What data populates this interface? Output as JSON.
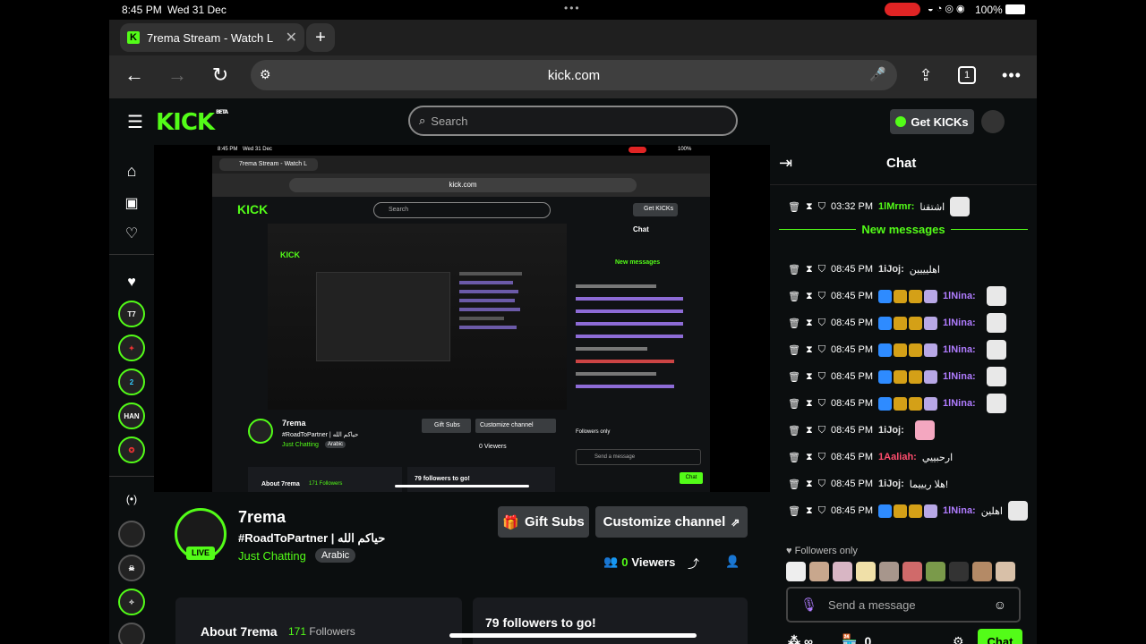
{
  "status_bar": {
    "time": "8:45 PM",
    "date": "Wed 31 Dec",
    "battery": "100%"
  },
  "browser": {
    "tab_title": "7rema Stream - Watch L",
    "url": "kick.com",
    "tab_count": "1"
  },
  "header": {
    "logo": "KICK",
    "logo_badge": "BETA",
    "search_placeholder": "Search",
    "get_kicks": "Get KICKs"
  },
  "nested_screen": {
    "time": "8:45 PM",
    "date": "Wed 31 Dec",
    "battery": "100%",
    "tab_title": "7rema Stream - Watch L",
    "url": "kick.com",
    "search_placeholder": "Search",
    "get_kicks": "Get KICKs",
    "chat_title": "Chat",
    "new_messages": "New messages",
    "channel_name": "7rema",
    "channel_title": "#RoadToPartner | حياكم الله",
    "category": "Just Chatting",
    "language": "Arabic",
    "viewers": "0 Viewers",
    "gift_subs": "Gift Subs",
    "customize": "Customize channel",
    "about": "About 7rema",
    "followers": "171 Followers",
    "followers_to_go": "79 followers to go!",
    "followers_only": "Followers only",
    "send_message": "Send a message",
    "chat_button": "Chat"
  },
  "channel": {
    "name": "7rema",
    "title": "#RoadToPartner | حياكم الله",
    "category": "Just Chatting",
    "language": "Arabic",
    "live_label": "LIVE",
    "viewer_count": "0",
    "viewers_label": "Viewers",
    "gift_subs": "Gift Subs",
    "customize": "Customize channel",
    "about_label": "About 7rema",
    "follower_count": "171",
    "followers_label": "Followers",
    "followers_to_go": "79 followers to go!"
  },
  "chat": {
    "title": "Chat",
    "new_messages": "New messages",
    "messages": [
      {
        "time": "03:32 PM",
        "user": "1lMrmr:",
        "text": "اشتقنا",
        "color": "#53fc18"
      },
      {
        "time": "08:45 PM",
        "user": "1iJoj:",
        "text": "اهليييين",
        "color": "#e5e5e5"
      },
      {
        "time": "08:45 PM",
        "user": "1lNina:",
        "text": "",
        "color": "#b07cff"
      },
      {
        "time": "08:45 PM",
        "user": "1lNina:",
        "text": "",
        "color": "#b07cff"
      },
      {
        "time": "08:45 PM",
        "user": "1lNina:",
        "text": "",
        "color": "#b07cff"
      },
      {
        "time": "08:45 PM",
        "user": "1lNina:",
        "text": "",
        "color": "#b07cff"
      },
      {
        "time": "08:45 PM",
        "user": "1lNina:",
        "text": "",
        "color": "#b07cff"
      },
      {
        "time": "08:45 PM",
        "user": "1iJoj:",
        "text": "",
        "color": "#e5e5e5"
      },
      {
        "time": "08:45 PM",
        "user": "1Aaliah:",
        "text": "ارحبييي",
        "color": "#ff4d6d"
      },
      {
        "time": "08:45 PM",
        "user": "1iJoj:",
        "text": "هلا ريييما!",
        "color": "#e5e5e5"
      },
      {
        "time": "08:45 PM",
        "user": "1lNina:",
        "text": "اهلين",
        "color": "#b07cff"
      }
    ],
    "followers_only": "Followers only",
    "send_placeholder": "Send a message",
    "infinity": "∞",
    "points": "0",
    "chat_button": "Chat"
  }
}
